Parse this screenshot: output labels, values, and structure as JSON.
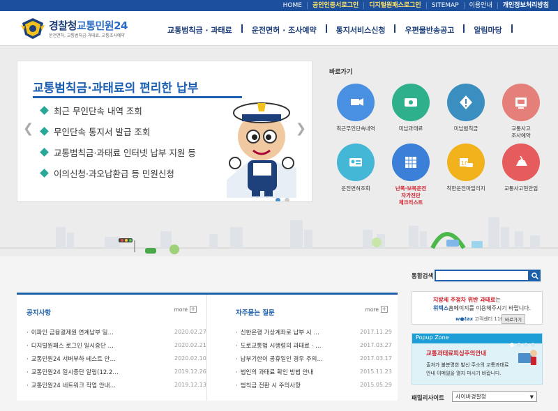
{
  "top_links": [
    {
      "label": "HOME",
      "style": "normal"
    },
    {
      "label": "공인인증서로그인",
      "style": "hl"
    },
    {
      "label": "디지털원패스로그인",
      "style": "hl"
    },
    {
      "label": "SITEMAP",
      "style": "normal"
    },
    {
      "label": "이용안내",
      "style": "normal"
    },
    {
      "label": "개인정보처리방침",
      "style": "wb"
    }
  ],
  "logo": {
    "name_a": "경찰청",
    "name_b": "교통민원24",
    "sub": "운전면허, 교통범칙금·과태료, 교통조사예약"
  },
  "gnb": [
    "교통범칙금 · 과태료",
    "운전면허 · 조사예약",
    "통지서비스신청",
    "우편물반송공고",
    "알림마당"
  ],
  "banner": {
    "title": "교통범칙금·과태료의 편리한 납부",
    "items": [
      "최근 무인단속 내역 조회",
      "무인단속 통지서 발급 조회",
      "교통범칙금·과태료 인터넷 납부 지원 등",
      "이의신청·과오납환급 등 민원신청"
    ],
    "arrow_left": "❮",
    "arrow_right": "❯"
  },
  "quick": {
    "title": "바로가기",
    "items": [
      {
        "label": "최근무인단속내역",
        "color": "#4a90e2"
      },
      {
        "label": "미납과태료",
        "color": "#2fb08c"
      },
      {
        "label": "미납범칙금",
        "color": "#3a8fc0"
      },
      {
        "label": "교통사고\n조사예약",
        "color": "#e57f7a"
      },
      {
        "label": "운전면허조회",
        "color": "#44b7d6"
      },
      {
        "label": "난폭·보복운전\n자가진단\n체크리스트",
        "color": "#3c7fd9",
        "red": true
      },
      {
        "label": "착한운전마일리지",
        "color": "#f2b21c"
      },
      {
        "label": "교통사고현안업",
        "color": "#e65b5b"
      }
    ]
  },
  "boards": {
    "notice": {
      "title": "공지사항",
      "more": "more",
      "rows": [
        {
          "t": "이파인 금융결제원 연계납부 일…",
          "d": "2020.02.27"
        },
        {
          "t": "디지털원패스 로그인 일시중단 …",
          "d": "2020.02.21"
        },
        {
          "t": "교통민원24 서버부하 테스트 안…",
          "d": "2020.02.10"
        },
        {
          "t": "교통민원24 일시중단 알림(12.2…",
          "d": "2019.12.26"
        },
        {
          "t": "교통민원24 네트워크 작업 안내…",
          "d": "2019.12.13"
        }
      ]
    },
    "faq": {
      "title": "자주묻는 질문",
      "more": "more",
      "rows": [
        {
          "t": "신한은행 가상계좌로 납부 시 …",
          "d": "2017.11.29"
        },
        {
          "t": "도로교통법 시행령의 과태료 · …",
          "d": "2017.03.27"
        },
        {
          "t": "납부기한이 공휴일인 경우 주의…",
          "d": "2017.03.17"
        },
        {
          "t": "법인의 과태료 확인 방법 안내",
          "d": "2015.11.23"
        },
        {
          "t": "범칙금 전환 시 주의사항",
          "d": "2015.05.29"
        }
      ]
    }
  },
  "search": {
    "label": "통합검색",
    "value": ""
  },
  "wetax": {
    "l1_red": "지방세 주정차 위반 과태료",
    "l1_rest": "는",
    "l2_bold": "위택스",
    "l2_rest": "홈페이지를 이용해주시기 바랍니다.",
    "brand": "w●tax",
    "center": "고객센터 110번",
    "button": "바로가기"
  },
  "popup": {
    "header": "Popup Zone",
    "title": "교통과태료피싱주의안내",
    "b1": "출처가 불분명한 발신 주소의 교통과태료",
    "b2": "안내 이메일을 열지 마시기 바랍니다."
  },
  "family": {
    "label": "패밀리사이트",
    "selected": "사이버경찰청",
    "arrow": "▼"
  }
}
